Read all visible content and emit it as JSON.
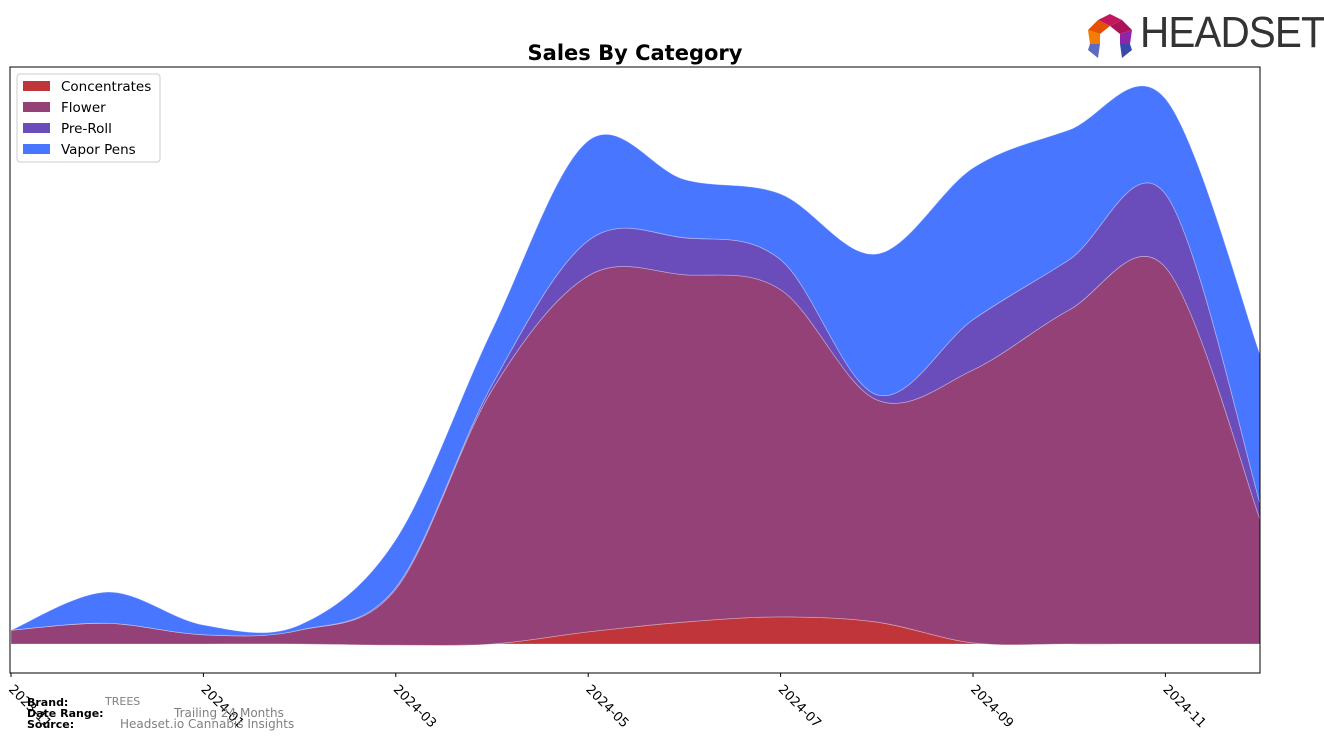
{
  "brand_logo": {
    "text": "HEADSET"
  },
  "meta": {
    "brand_label": "Brand:",
    "brand_value": "TREES",
    "date_range_label": "Date Range:",
    "date_range_value": "Trailing 24 Months",
    "source_label": "Source:",
    "source_value": "Headset.io Cannabis Insights"
  },
  "chart_data": {
    "type": "area",
    "stacked": true,
    "smooth": true,
    "title": "Sales By Category",
    "xlabel": "",
    "ylabel": "",
    "x": [
      "2023-11",
      "2023-12",
      "2024-01",
      "2024-02",
      "2024-03",
      "2024-04",
      "2024-05",
      "2024-06",
      "2024-07",
      "2024-08",
      "2024-09",
      "2024-10",
      "2024-11",
      "2024-12"
    ],
    "xticks": [
      "2023-11",
      "2024-01",
      "2024-03",
      "2024-05",
      "2024-07",
      "2024-09",
      "2024-11"
    ],
    "ylim": [
      0,
      100
    ],
    "y_ticks_visible": false,
    "grid": false,
    "legend_position": "top-left",
    "series": [
      {
        "name": "Concentrates",
        "color": "#c0353a",
        "values": [
          0,
          0,
          0,
          0,
          -0.2,
          0,
          2.1,
          3.8,
          4.7,
          3.8,
          0.2,
          0,
          0,
          0
        ]
      },
      {
        "name": "Flower",
        "color": "#944178",
        "values": [
          2.4,
          3.6,
          1.6,
          2.4,
          9.7,
          44.0,
          61.7,
          60.2,
          56.7,
          38.5,
          47.3,
          57.9,
          65.3,
          20.8
        ]
      },
      {
        "name": "Pre-Roll",
        "color": "#6a4dbb",
        "values": [
          0,
          0,
          0,
          0,
          0.3,
          0.9,
          6.1,
          6.4,
          5.2,
          0.9,
          8.7,
          8.7,
          12.7,
          2.6
        ]
      },
      {
        "name": "Vapor Pens",
        "color": "#4876ff",
        "values": [
          0,
          5.4,
          1.7,
          0.9,
          8.3,
          9.5,
          17.3,
          10.1,
          11.4,
          24.4,
          26.3,
          22.5,
          16.5,
          26.0
        ]
      }
    ]
  }
}
